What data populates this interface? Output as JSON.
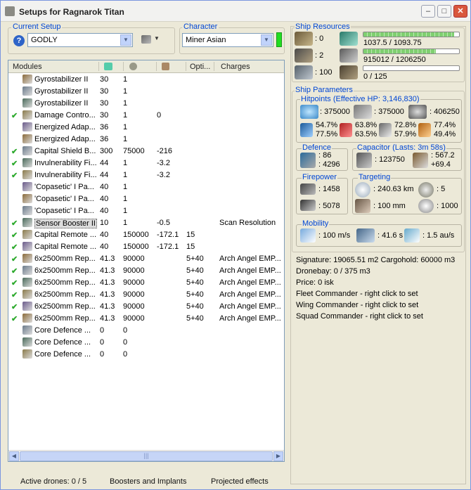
{
  "window": {
    "title": "Setups for Ragnarok Titan"
  },
  "setup": {
    "label": "Current Setup",
    "value": "GODLY"
  },
  "character": {
    "label": "Character",
    "value": "Miner Asian"
  },
  "columns": [
    "Modules",
    "Opti...",
    "Charges"
  ],
  "modules": [
    {
      "checked": false,
      "name": "Gyrostabilizer II",
      "c1": "30",
      "c2": "1",
      "c3": "",
      "opt": "",
      "charge": ""
    },
    {
      "checked": false,
      "name": "Gyrostabilizer II",
      "c1": "30",
      "c2": "1",
      "c3": "",
      "opt": "",
      "charge": ""
    },
    {
      "checked": false,
      "name": "Gyrostabilizer II",
      "c1": "30",
      "c2": "1",
      "c3": "",
      "opt": "",
      "charge": ""
    },
    {
      "checked": true,
      "name": "Damage Contro...",
      "c1": "30",
      "c2": "1",
      "c3": "0",
      "opt": "",
      "charge": ""
    },
    {
      "checked": false,
      "name": "Energized Adap...",
      "c1": "36",
      "c2": "1",
      "c3": "",
      "opt": "",
      "charge": ""
    },
    {
      "checked": false,
      "name": "Energized Adap...",
      "c1": "36",
      "c2": "1",
      "c3": "",
      "opt": "",
      "charge": ""
    },
    {
      "checked": true,
      "name": "Capital Shield B...",
      "c1": "300",
      "c2": "75000",
      "c3": "-216",
      "opt": "",
      "charge": ""
    },
    {
      "checked": true,
      "name": "Invulnerability Fi...",
      "c1": "44",
      "c2": "1",
      "c3": "-3.2",
      "opt": "",
      "charge": ""
    },
    {
      "checked": true,
      "name": "Invulnerability Fi...",
      "c1": "44",
      "c2": "1",
      "c3": "-3.2",
      "opt": "",
      "charge": ""
    },
    {
      "checked": false,
      "name": "'Copasetic' I Pa...",
      "c1": "40",
      "c2": "1",
      "c3": "",
      "opt": "",
      "charge": ""
    },
    {
      "checked": false,
      "name": "'Copasetic' I Pa...",
      "c1": "40",
      "c2": "1",
      "c3": "",
      "opt": "",
      "charge": ""
    },
    {
      "checked": false,
      "name": "'Copasetic' I Pa...",
      "c1": "40",
      "c2": "1",
      "c3": "",
      "opt": "",
      "charge": ""
    },
    {
      "checked": true,
      "name": "Sensor Booster II",
      "c1": "10",
      "c2": "1",
      "c3": "-0.5",
      "opt": "",
      "charge": "Scan Resolution",
      "selected": true
    },
    {
      "checked": true,
      "name": "Capital Remote ...",
      "c1": "40",
      "c2": "150000",
      "c3": "-172.1",
      "opt": "15",
      "charge": ""
    },
    {
      "checked": true,
      "name": "Capital Remote ...",
      "c1": "40",
      "c2": "150000",
      "c3": "-172.1",
      "opt": "15",
      "charge": ""
    },
    {
      "checked": true,
      "name": "6x2500mm Rep...",
      "c1": "41.3",
      "c2": "90000",
      "c3": "",
      "opt": "5+40",
      "charge": "Arch Angel EMP..."
    },
    {
      "checked": true,
      "name": "6x2500mm Rep...",
      "c1": "41.3",
      "c2": "90000",
      "c3": "",
      "opt": "5+40",
      "charge": "Arch Angel EMP..."
    },
    {
      "checked": true,
      "name": "6x2500mm Rep...",
      "c1": "41.3",
      "c2": "90000",
      "c3": "",
      "opt": "5+40",
      "charge": "Arch Angel EMP..."
    },
    {
      "checked": true,
      "name": "6x2500mm Rep...",
      "c1": "41.3",
      "c2": "90000",
      "c3": "",
      "opt": "5+40",
      "charge": "Arch Angel EMP..."
    },
    {
      "checked": true,
      "name": "6x2500mm Rep...",
      "c1": "41.3",
      "c2": "90000",
      "c3": "",
      "opt": "5+40",
      "charge": "Arch Angel EMP..."
    },
    {
      "checked": true,
      "name": "6x2500mm Rep...",
      "c1": "41.3",
      "c2": "90000",
      "c3": "",
      "opt": "5+40",
      "charge": "Arch Angel EMP..."
    },
    {
      "checked": false,
      "name": "Core Defence ...",
      "c1": "0",
      "c2": "0",
      "c3": "",
      "opt": "",
      "charge": ""
    },
    {
      "checked": false,
      "name": "Core Defence ...",
      "c1": "0",
      "c2": "0",
      "c3": "",
      "opt": "",
      "charge": ""
    },
    {
      "checked": false,
      "name": "Core Defence ...",
      "c1": "0",
      "c2": "0",
      "c3": "",
      "opt": "",
      "charge": ""
    }
  ],
  "bottom_tabs": [
    "Active drones: 0 / 5",
    "Boosters and Implants",
    "Projected effects"
  ],
  "resources": {
    "label": "Ship Resources",
    "hardpoints": [
      ": 0",
      ": 2",
      ": 100"
    ],
    "cpu": {
      "text": "1037.5 / 1093.75",
      "fill": 0.949
    },
    "power": {
      "text": "915012 / 1206250",
      "fill": 0.759
    },
    "drone": {
      "text": "0 / 125",
      "fill": 0
    }
  },
  "params": {
    "label": "Ship Parameters",
    "hp_title": "Hitpoints (Effective HP: 3,146,830)",
    "hp": [
      ": 375000",
      ": 375000",
      ": 406250"
    ],
    "res": [
      "54.7%",
      "77.5%",
      "63.8%",
      "63.5%",
      "72.8%",
      "57.9%",
      "77.4%",
      "49.4%"
    ],
    "defence": {
      "label": "Defence",
      "a": ": 86",
      "b": ": 4296"
    },
    "capacitor": {
      "label": "Capacitor (Lasts: 3m 58s)",
      "a": ": 123750",
      "b": ": 567.2",
      "c": "+69.4"
    },
    "firepower": {
      "label": "Firepower",
      "a": ": 1458",
      "b": ": 5078"
    },
    "targeting": {
      "label": "Targeting",
      "range": ": 240.63 km",
      "targets": ": 5",
      "sig": ": 100 mm",
      "scan": ": 1000"
    },
    "mobility": {
      "label": "Mobility",
      "speed": ": 100 m/s",
      "align": ": 41.6 s",
      "warp": ": 1.5 au/s"
    }
  },
  "info": [
    "Signature: 19065.51 m2  Cargohold: 60000 m3",
    "Dronebay: 0 / 375 m3",
    "Price: 0 isk",
    "Fleet Commander - right click to set",
    "Wing Commander - right click to set",
    "Squad Commander - right click to set"
  ]
}
